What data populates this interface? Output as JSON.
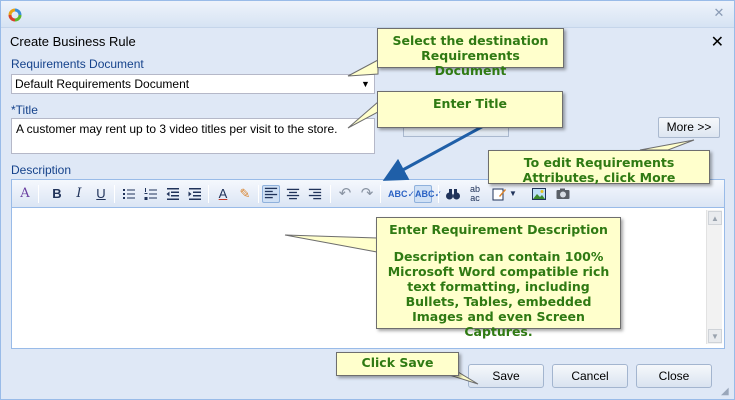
{
  "dialog": {
    "title": "Create Business Rule",
    "close_glyph": "✕",
    "titlebar_close_glyph": "✕"
  },
  "requirements_document": {
    "label": "Requirements Document",
    "value": "Default Requirements Document"
  },
  "title_field": {
    "label": "*Title",
    "value": "A customer may rent up to 3 video titles per visit to the store."
  },
  "more_button": {
    "label": "More >>"
  },
  "description": {
    "label": "Description"
  },
  "toolbar": {
    "icons": [
      "font-size-icon",
      "bold-icon",
      "italic-icon",
      "underline-icon",
      "bullet-list-icon",
      "numbered-list-icon",
      "outdent-icon",
      "indent-icon",
      "font-color-icon",
      "highlight-icon",
      "align-left-icon",
      "align-center-icon",
      "align-right-icon",
      "undo-icon",
      "redo-icon",
      "spellcheck-icon",
      "spellcheck-options-icon",
      "find-icon",
      "replace-icon",
      "insert-menu-icon",
      "insert-image-icon",
      "screen-capture-icon"
    ],
    "bold": "B",
    "italic": "I",
    "underline": "U"
  },
  "buttons": {
    "save": "Save",
    "cancel": "Cancel",
    "close": "Close"
  },
  "callouts": {
    "select_doc": "Select the destination Requirements Document",
    "enter_title": "Enter Title",
    "edit_attrs": "To edit Requirements Attributes, click More",
    "enter_desc_heading": "Enter Requirement Description",
    "enter_desc_body": "Description can contain 100% Microsoft Word compatible rich text formatting,  including Bullets, Tables, embedded Images and even Screen Captures.",
    "click_save": "Click Save"
  },
  "colors": {
    "dialog_bg": "#dfe8f6",
    "label": "#15428b",
    "callout_bg": "#ffffcc",
    "callout_text": "#2f7a13",
    "arrow": "#1f5fa8"
  }
}
